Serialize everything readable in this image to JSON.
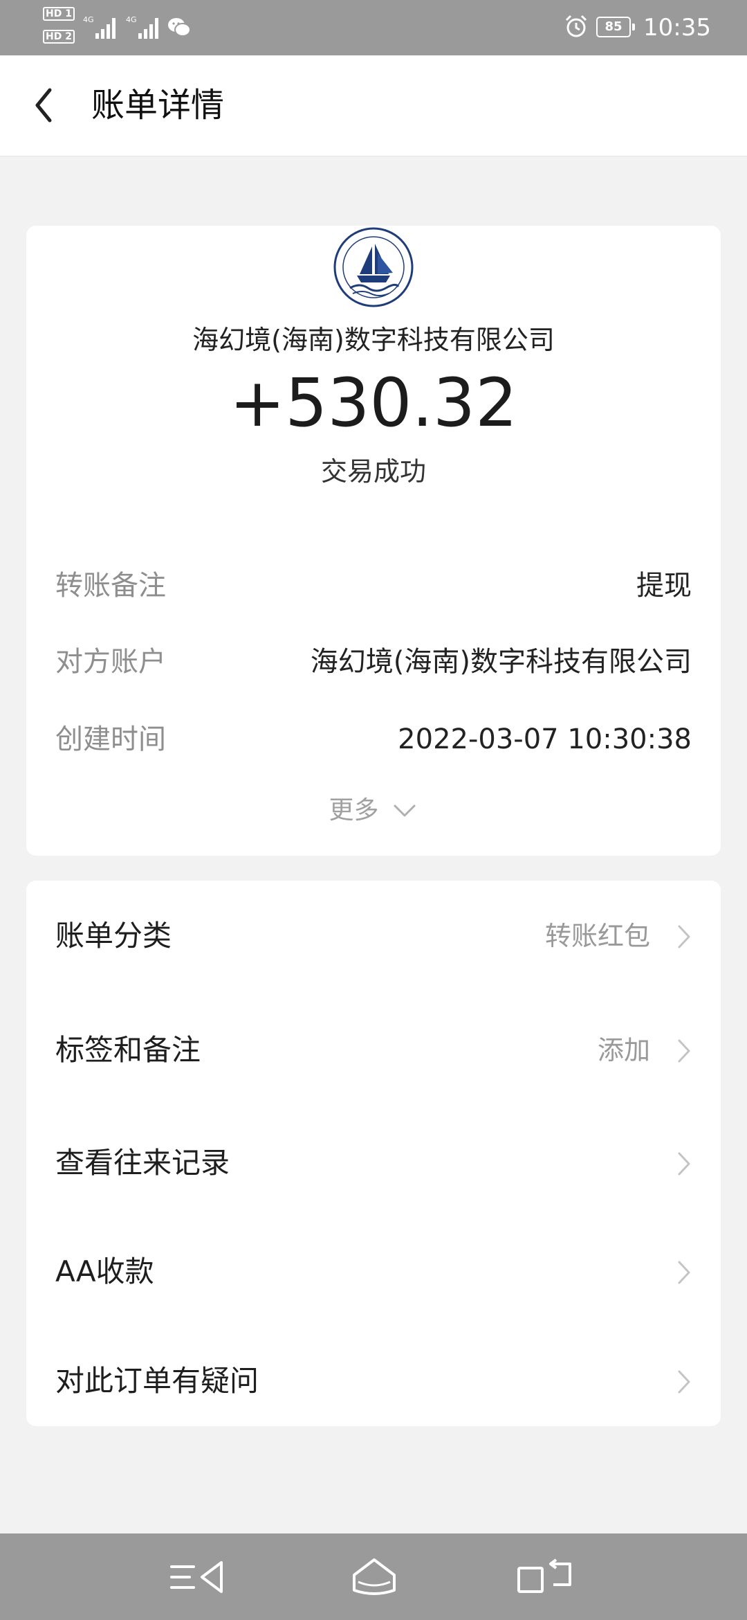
{
  "status_bar": {
    "hd1": "HD 1",
    "hd2": "HD 2",
    "network1": "4G",
    "network2": "4G",
    "battery": "85",
    "time": "10:35"
  },
  "header": {
    "title": "账单详情",
    "back_icon": "chevron-left-icon"
  },
  "transaction": {
    "logo_icon": "sailing-ship-logo",
    "counterparty": "海幻境(海南)数字科技有限公司",
    "amount": "+530.32",
    "status": "交易成功"
  },
  "details": [
    {
      "label": "转账备注",
      "value": "提现"
    },
    {
      "label": "对方账户",
      "value": "海幻境(海南)数字科技有限公司"
    },
    {
      "label": "创建时间",
      "value": "2022-03-07 10:30:38"
    }
  ],
  "more": {
    "label": "更多",
    "icon": "chevron-down-icon"
  },
  "menu": [
    {
      "label": "账单分类",
      "value": "转账红包"
    },
    {
      "label": "标签和备注",
      "value": "添加"
    },
    {
      "label": "查看往来记录",
      "value": ""
    },
    {
      "label": "AA收款",
      "value": ""
    },
    {
      "label": "对此订单有疑问",
      "value": ""
    }
  ],
  "colors": {
    "background": "#f2f2f2",
    "card": "#ffffff",
    "system_bar": "#9a9a9a",
    "label_gray": "#8e8e8e",
    "text_dark": "#222222",
    "logo_blue": "#1f3c7a"
  }
}
